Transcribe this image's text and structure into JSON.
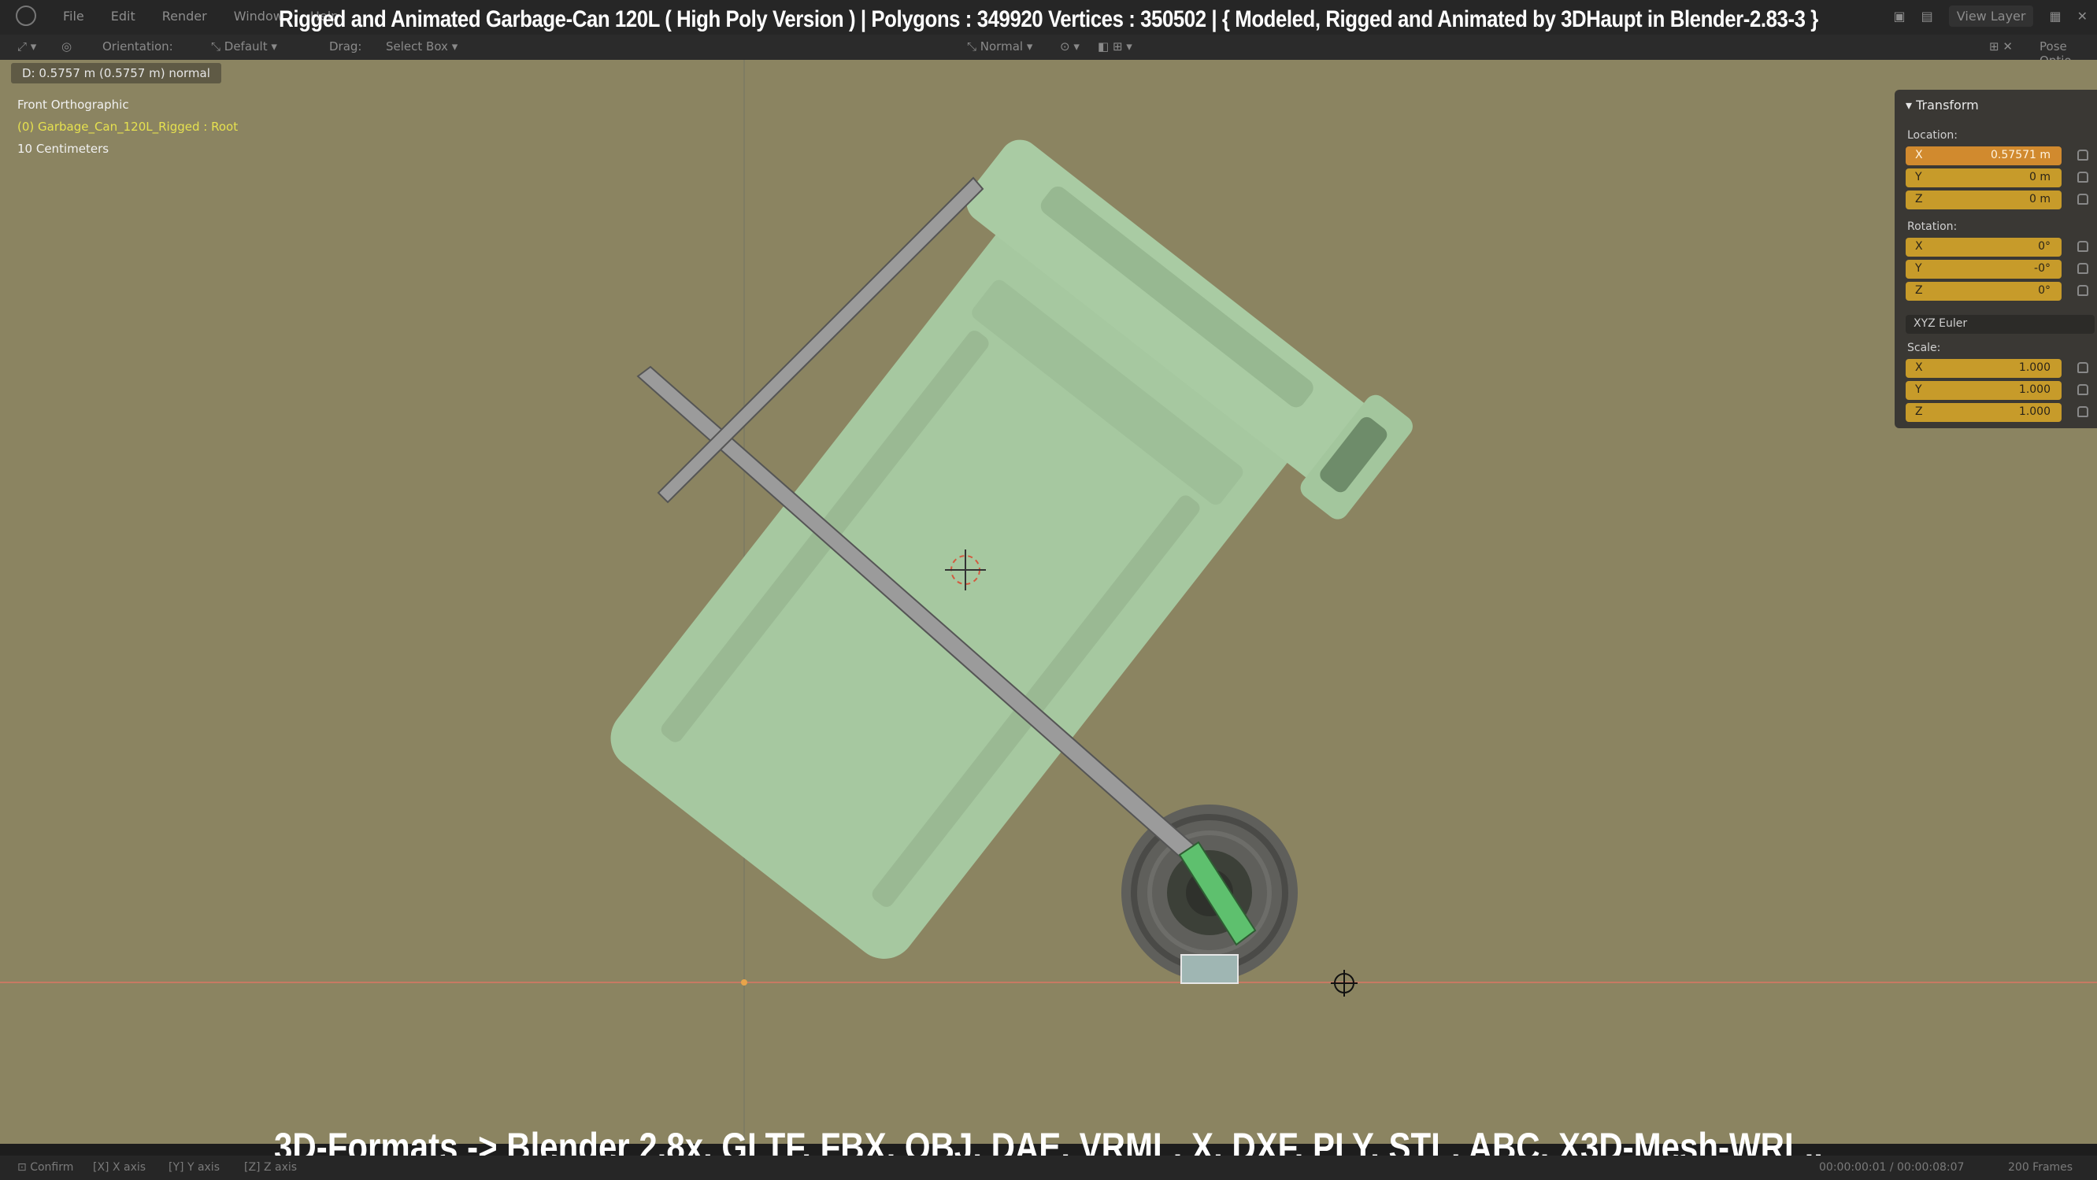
{
  "title_overlay": "Rigged and Animated Garbage-Can 120L ( High Poly Version ) |  Polygons : 349920  Vertices : 350502   |   { Modeled, Rigged and Animated by 3DHaupt in Blender-2.83-3 }",
  "menu": {
    "file": "File",
    "edit": "Edit",
    "render": "Render",
    "window": "Window",
    "help": "Help"
  },
  "topright": {
    "view_layer": "View Layer"
  },
  "header": {
    "orientation": "Orientation:",
    "orientation_value": "Default",
    "drag": "Drag:",
    "drag_value": "Select Box",
    "transform_orientation": "Normal",
    "pose_options": "Pose Optio"
  },
  "viewport": {
    "measure": "D: 0.5757 m (0.5757 m) normal",
    "view_name": "Front Orthographic",
    "object_name": "(0) Garbage_Can_120L_Rigged : Root",
    "scale_text": "10 Centimeters"
  },
  "transform_panel": {
    "title": "Transform",
    "location_label": "Location:",
    "location": [
      {
        "axis": "X",
        "value": "0.57571 m"
      },
      {
        "axis": "Y",
        "value": "0 m"
      },
      {
        "axis": "Z",
        "value": "0 m"
      }
    ],
    "rotation_label": "Rotation:",
    "rotation": [
      {
        "axis": "X",
        "value": "0°"
      },
      {
        "axis": "Y",
        "value": "-0°"
      },
      {
        "axis": "Z",
        "value": "0°"
      }
    ],
    "rotation_mode": "XYZ Euler",
    "scale_label": "Scale:",
    "scale": [
      {
        "axis": "X",
        "value": "1.000"
      },
      {
        "axis": "Y",
        "value": "1.000"
      },
      {
        "axis": "Z",
        "value": "1.000"
      }
    ]
  },
  "status": {
    "confirm": "Confirm",
    "x_axis": "X axis",
    "y_axis": "Y axis",
    "z_axis": "Z axis",
    "time": "00:00:00:01 / 00:00:08:07",
    "frames": "200 Frames"
  },
  "formats_overlay": "3D-Formats -> Blender 2.8x, GLTF, FBX, OBJ, DAE, VRML, X, DXF, PLY, STL, ABC, X3D-Mesh-WRL..",
  "colors": {
    "viewport_bg": "#8b8461",
    "can_green": "#9fc39a",
    "bone_grey": "#9a9a9a",
    "active_bone": "#5ec06e",
    "field_orange": "#c79b2a"
  }
}
